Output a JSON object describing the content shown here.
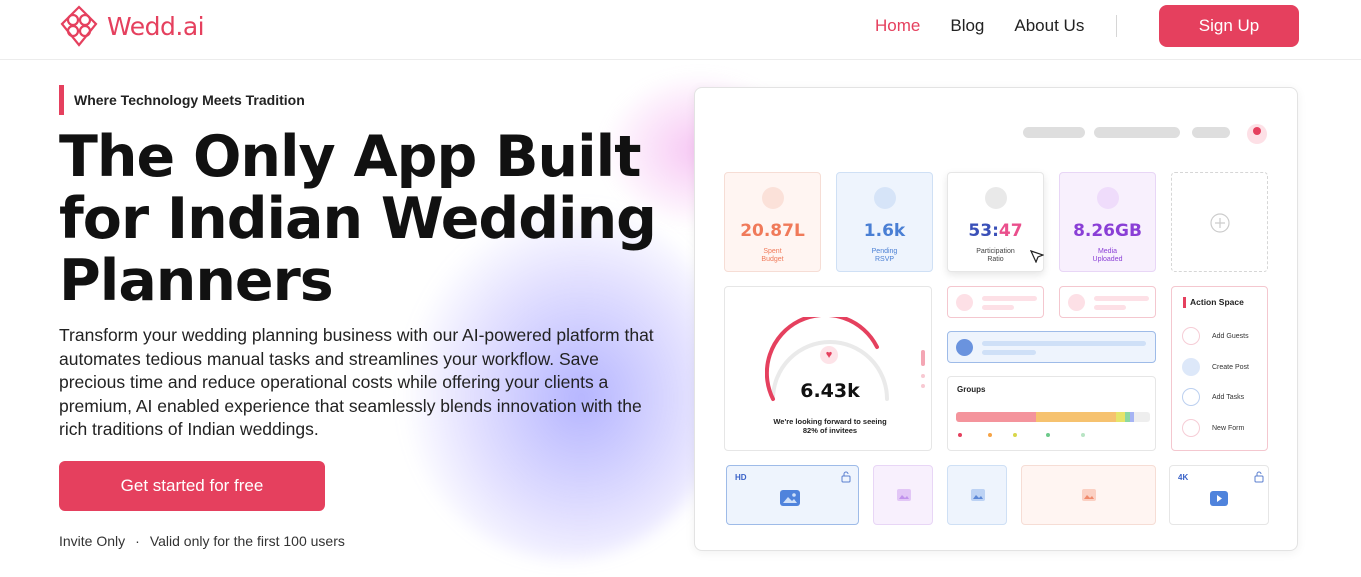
{
  "nav": {
    "brand": "Wedd.ai",
    "links": [
      {
        "label": "Home",
        "active": true
      },
      {
        "label": "Blog",
        "active": false
      },
      {
        "label": "About Us",
        "active": false
      }
    ],
    "signup_label": "Sign Up"
  },
  "hero": {
    "tagline": "Where Technology Meets Tradition",
    "headline": "The Only App Built for Indian Wedding Planners",
    "description": "Transform your wedding planning business with our AI-powered platform that automates tedious manual tasks and streamlines your workflow. Save precious time and reduce operational costs while offering your clients a premium, AI enabled experience that seamlessly blends innovation with the rich traditions of Indian weddings.",
    "cta_label": "Get started for free",
    "fineprint": [
      "Invite Only",
      "·",
      "Valid only for the first 100 users"
    ]
  },
  "dashboard": {
    "stats": [
      {
        "value": "20.87L",
        "label": "Spent\nBudget",
        "color": "#f07a5a"
      },
      {
        "value": "1.6k",
        "label": "Pending\nRSVP",
        "color": "#4a7fd4"
      },
      {
        "value_a": "53",
        "value_sep": ":",
        "value_b": "47",
        "label": "Participation\nRatio",
        "color_a": "#3a50b8",
        "color_b": "#ea4f8c"
      },
      {
        "value": "8.26GB",
        "label": "Media\nUploaded",
        "color": "#8a3fd6"
      }
    ],
    "gauge_value": "6.43k",
    "gauge_caption": "We're looking forward to seeing",
    "gauge_caption_2": "82% of invitees",
    "groups_label": "Groups",
    "action_space_title": "Action Space",
    "actions": [
      "Add Guests",
      "Create Post",
      "Add Tasks",
      "New Form"
    ],
    "media_tags": {
      "hd": "HD",
      "fourk": "4K"
    },
    "colors": {
      "accent": "#e5405e"
    }
  }
}
